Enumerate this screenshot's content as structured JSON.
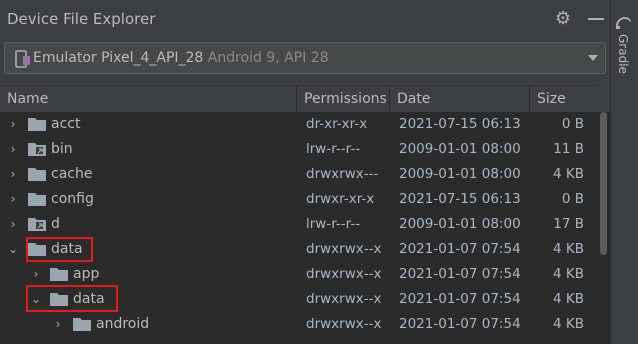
{
  "panel": {
    "title": "Device File Explorer",
    "settings_icon": "gear-icon",
    "minimize_icon": "minimize-icon"
  },
  "device": {
    "name": "Emulator Pixel_4_API_28",
    "detail": "Android 9, API 28"
  },
  "columns": {
    "name": "Name",
    "permissions": "Permissions",
    "date": "Date",
    "size": "Size"
  },
  "rows": [
    {
      "name": "acct",
      "perm": "dr-xr-xr-x",
      "date": "2021-07-15 06:13",
      "size": "0 B"
    },
    {
      "name": "bin",
      "perm": "lrw-r--r--",
      "date": "2009-01-01 08:00",
      "size": "11 B"
    },
    {
      "name": "cache",
      "perm": "drwxrwx---",
      "date": "2009-01-01 08:00",
      "size": "4 KB"
    },
    {
      "name": "config",
      "perm": "drwxr-xr-x",
      "date": "2021-07-15 06:13",
      "size": "0 B"
    },
    {
      "name": "d",
      "perm": "lrw-r--r--",
      "date": "2009-01-01 08:00",
      "size": "17 B"
    },
    {
      "name": "data",
      "perm": "drwxrwx--x",
      "date": "2021-01-07 07:54",
      "size": "4 KB"
    },
    {
      "name": "app",
      "perm": "drwxrwx--x",
      "date": "2021-01-07 07:54",
      "size": "4 KB"
    },
    {
      "name": "data",
      "perm": "drwxrwx--x",
      "date": "2021-01-07 07:54",
      "size": "4 KB"
    },
    {
      "name": "android",
      "perm": "drwxrwx--x",
      "date": "2021-01-07 07:54",
      "size": "4 KB"
    }
  ],
  "sidebar": {
    "gradle_label": "Gradle"
  },
  "colors": {
    "background": "#3c3f41",
    "table_bg": "#2b2b2b",
    "text": "#bbbbbb",
    "highlight": "#e51b1b",
    "folder": "#9aa7b0"
  }
}
